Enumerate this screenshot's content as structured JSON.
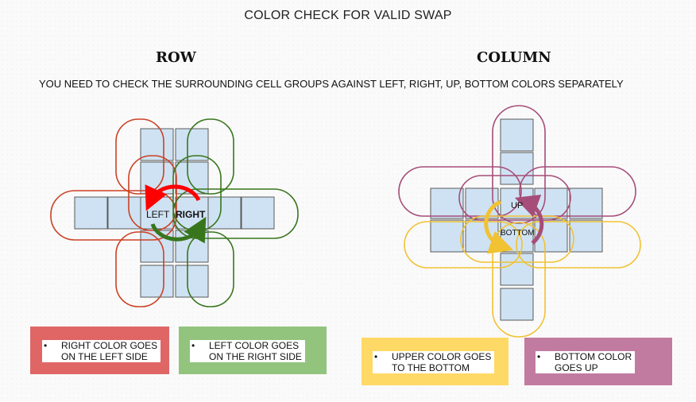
{
  "title": "COLOR CHECK FOR VALID SWAP",
  "row_heading": "ROW",
  "column_heading": "COLUMN",
  "subtitle": "YOU NEED TO CHECK THE SURROUNDING CELL GROUPS  AGAINST LEFT, RIGHT, UP, BOTTOM COLORS SEPARATELY",
  "row_diagram": {
    "left_label": "LEFT",
    "right_label": "RIGHT"
  },
  "column_diagram": {
    "up_label": "UP",
    "bottom_label": "BOTTOM"
  },
  "notes": [
    {
      "bullet": "•",
      "text": "RIGHT COLOR GOES\nON THE LEFT SIDE",
      "color": "#e06666"
    },
    {
      "bullet": "•",
      "text": "LEFT  COLOR GOES\nON THE RIGHT SIDE",
      "color": "#93c47d"
    },
    {
      "bullet": "•",
      "text": "UPPER COLOR GOES\nTO THE BOTTOM",
      "color": "#ffd966"
    },
    {
      "bullet": "•",
      "text": "BOTTOM  COLOR\nGOES UP",
      "color": "#c27ba0"
    }
  ],
  "colors": {
    "cell_fill": "#cfe2f3",
    "cell_stroke": "#595959",
    "red": "#cc4125",
    "green": "#38761d",
    "yellow": "#f1c232",
    "purple": "#a64d79",
    "arrow_red": "#ff0000",
    "arrow_green": "#38761d"
  }
}
